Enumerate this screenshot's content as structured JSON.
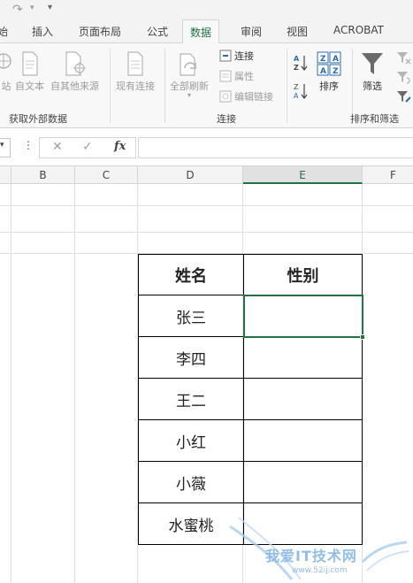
{
  "qat": {
    "redo_icon": "redo-icon",
    "dropdown_icon": "chevron-down-icon"
  },
  "tabs": {
    "home_partial": "始",
    "insert": "插入",
    "page_layout": "页面布局",
    "formulas": "公式",
    "data": "数据",
    "review": "审阅",
    "view": "视图",
    "acrobat": "ACROBAT"
  },
  "ribbon": {
    "get_external": {
      "from_web_partial": "站",
      "from_text": "自文本",
      "from_other": "自其他来源",
      "existing": "现有连接",
      "label": "获取外部数据"
    },
    "connections": {
      "refresh_all": "全部刷新",
      "connections": "连接",
      "properties": "属性",
      "edit_links": "编辑链接",
      "label": "连接"
    },
    "sort_filter": {
      "sort": "排序",
      "filter": "筛选",
      "label": "排序和筛选",
      "sort_az": "A↓Z",
      "sort_za": "Z↓A"
    }
  },
  "formula_bar": {
    "dots": "⋮",
    "cancel": "✕",
    "enter": "✓",
    "fx": "fx",
    "value": ""
  },
  "columns": [
    "B",
    "C",
    "D",
    "E",
    "F"
  ],
  "selected_column": "E",
  "table": {
    "headers": [
      "姓名",
      "性别"
    ],
    "rows": [
      {
        "name": "张三",
        "gender": ""
      },
      {
        "name": "李四",
        "gender": ""
      },
      {
        "name": "王二",
        "gender": ""
      },
      {
        "name": "小红",
        "gender": ""
      },
      {
        "name": "小薇",
        "gender": ""
      },
      {
        "name": "水蜜桃",
        "gender": ""
      }
    ]
  },
  "watermark": {
    "title": "我爱IT技术网",
    "url": "www.52ij.com"
  },
  "colors": {
    "accent": "#217346",
    "ribbon_bg": "#f8f8f8",
    "grid": "#e0e0e0"
  }
}
